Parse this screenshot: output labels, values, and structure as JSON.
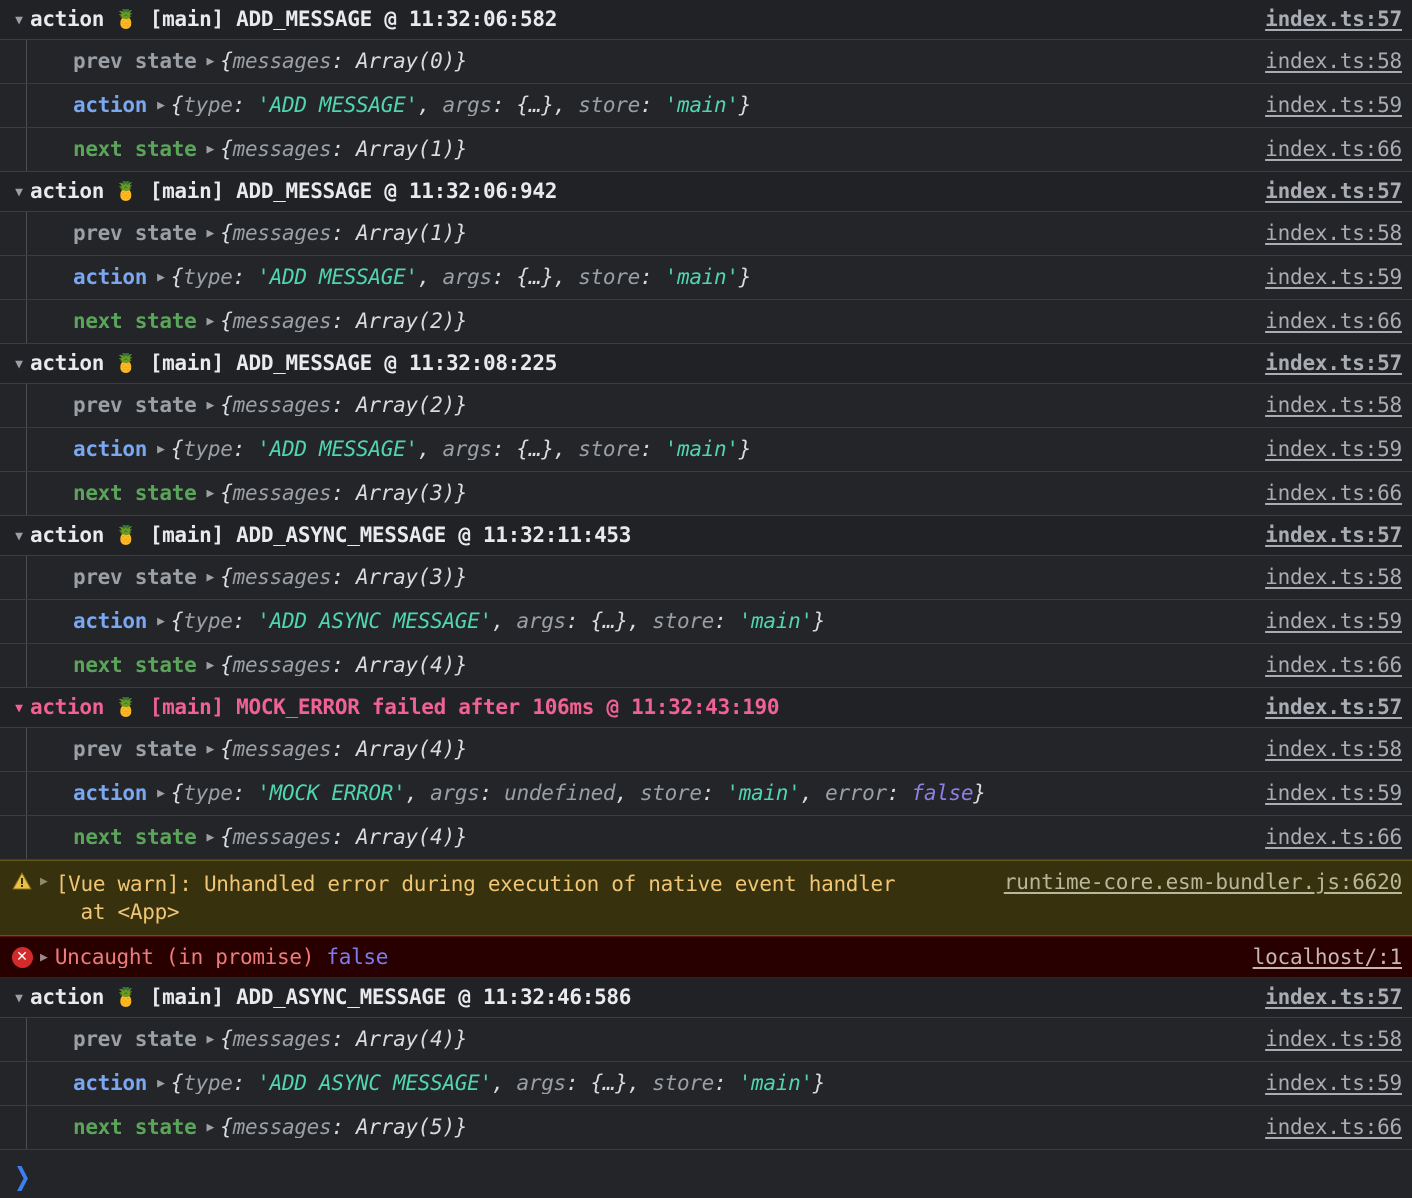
{
  "console": {
    "group_label": "action",
    "store_emoji": "🍍",
    "collapse_arrow": "▼",
    "expand_triangle": "▶",
    "prompt_chevron": "❯",
    "prompt_placeholder": "",
    "prompt_value": "",
    "colors": {
      "background": "#242528",
      "group_header_background": "#212226",
      "row_separator": "#3b3d40",
      "label_prev_state": "#9aa0a6",
      "label_action": "#7aa7f0",
      "label_next_state": "#5ba55b",
      "string_value": "#4fd6b0",
      "boolean_value": "#8c7fe8",
      "error_pink": "#f06292",
      "warning_background": "#37320d",
      "warning_text": "#f0c674",
      "error_background": "#290000",
      "error_text": "#ef7b7b",
      "link": "#a9adb3",
      "prompt_chevron": "#3b7ff0"
    },
    "labels": {
      "prev_state": "prev state",
      "action": "action",
      "next_state": "next state"
    },
    "entries": [
      {
        "kind": "group",
        "header": {
          "label": "action",
          "title": "[main] ADD_MESSAGE @ 11:32:06:582",
          "source": "index.ts:57",
          "failed": false
        },
        "rows": [
          {
            "label": "prev state",
            "label_kind": "prev",
            "source": "index.ts:58",
            "tokens": [
              {
                "t": "punc",
                "v": "{"
              },
              {
                "t": "key",
                "v": "messages"
              },
              {
                "t": "punc",
                "v": ": "
              },
              {
                "t": "obj",
                "v": "Array(0)"
              },
              {
                "t": "punc",
                "v": "}"
              }
            ]
          },
          {
            "label": "action",
            "label_kind": "action",
            "source": "index.ts:59",
            "tokens": [
              {
                "t": "punc",
                "v": "{"
              },
              {
                "t": "key",
                "v": "type"
              },
              {
                "t": "punc",
                "v": ": "
              },
              {
                "t": "str",
                "v": "'ADD_MESSAGE'"
              },
              {
                "t": "punc",
                "v": ", "
              },
              {
                "t": "key",
                "v": "args"
              },
              {
                "t": "punc",
                "v": ": "
              },
              {
                "t": "obj",
                "v": "{…}"
              },
              {
                "t": "punc",
                "v": ", "
              },
              {
                "t": "key",
                "v": "store"
              },
              {
                "t": "punc",
                "v": ": "
              },
              {
                "t": "str",
                "v": "'main'"
              },
              {
                "t": "punc",
                "v": "}"
              }
            ]
          },
          {
            "label": "next state",
            "label_kind": "next",
            "source": "index.ts:66",
            "tokens": [
              {
                "t": "punc",
                "v": "{"
              },
              {
                "t": "key",
                "v": "messages"
              },
              {
                "t": "punc",
                "v": ": "
              },
              {
                "t": "obj",
                "v": "Array(1)"
              },
              {
                "t": "punc",
                "v": "}"
              }
            ]
          }
        ]
      },
      {
        "kind": "group",
        "header": {
          "label": "action",
          "title": "[main] ADD_MESSAGE @ 11:32:06:942",
          "source": "index.ts:57",
          "failed": false
        },
        "rows": [
          {
            "label": "prev state",
            "label_kind": "prev",
            "source": "index.ts:58",
            "tokens": [
              {
                "t": "punc",
                "v": "{"
              },
              {
                "t": "key",
                "v": "messages"
              },
              {
                "t": "punc",
                "v": ": "
              },
              {
                "t": "obj",
                "v": "Array(1)"
              },
              {
                "t": "punc",
                "v": "}"
              }
            ]
          },
          {
            "label": "action",
            "label_kind": "action",
            "source": "index.ts:59",
            "tokens": [
              {
                "t": "punc",
                "v": "{"
              },
              {
                "t": "key",
                "v": "type"
              },
              {
                "t": "punc",
                "v": ": "
              },
              {
                "t": "str",
                "v": "'ADD_MESSAGE'"
              },
              {
                "t": "punc",
                "v": ", "
              },
              {
                "t": "key",
                "v": "args"
              },
              {
                "t": "punc",
                "v": ": "
              },
              {
                "t": "obj",
                "v": "{…}"
              },
              {
                "t": "punc",
                "v": ", "
              },
              {
                "t": "key",
                "v": "store"
              },
              {
                "t": "punc",
                "v": ": "
              },
              {
                "t": "str",
                "v": "'main'"
              },
              {
                "t": "punc",
                "v": "}"
              }
            ]
          },
          {
            "label": "next state",
            "label_kind": "next",
            "source": "index.ts:66",
            "tokens": [
              {
                "t": "punc",
                "v": "{"
              },
              {
                "t": "key",
                "v": "messages"
              },
              {
                "t": "punc",
                "v": ": "
              },
              {
                "t": "obj",
                "v": "Array(2)"
              },
              {
                "t": "punc",
                "v": "}"
              }
            ]
          }
        ]
      },
      {
        "kind": "group",
        "header": {
          "label": "action",
          "title": "[main] ADD_MESSAGE @ 11:32:08:225",
          "source": "index.ts:57",
          "failed": false
        },
        "rows": [
          {
            "label": "prev state",
            "label_kind": "prev",
            "source": "index.ts:58",
            "tokens": [
              {
                "t": "punc",
                "v": "{"
              },
              {
                "t": "key",
                "v": "messages"
              },
              {
                "t": "punc",
                "v": ": "
              },
              {
                "t": "obj",
                "v": "Array(2)"
              },
              {
                "t": "punc",
                "v": "}"
              }
            ]
          },
          {
            "label": "action",
            "label_kind": "action",
            "source": "index.ts:59",
            "tokens": [
              {
                "t": "punc",
                "v": "{"
              },
              {
                "t": "key",
                "v": "type"
              },
              {
                "t": "punc",
                "v": ": "
              },
              {
                "t": "str",
                "v": "'ADD_MESSAGE'"
              },
              {
                "t": "punc",
                "v": ", "
              },
              {
                "t": "key",
                "v": "args"
              },
              {
                "t": "punc",
                "v": ": "
              },
              {
                "t": "obj",
                "v": "{…}"
              },
              {
                "t": "punc",
                "v": ", "
              },
              {
                "t": "key",
                "v": "store"
              },
              {
                "t": "punc",
                "v": ": "
              },
              {
                "t": "str",
                "v": "'main'"
              },
              {
                "t": "punc",
                "v": "}"
              }
            ]
          },
          {
            "label": "next state",
            "label_kind": "next",
            "source": "index.ts:66",
            "tokens": [
              {
                "t": "punc",
                "v": "{"
              },
              {
                "t": "key",
                "v": "messages"
              },
              {
                "t": "punc",
                "v": ": "
              },
              {
                "t": "obj",
                "v": "Array(3)"
              },
              {
                "t": "punc",
                "v": "}"
              }
            ]
          }
        ]
      },
      {
        "kind": "group",
        "header": {
          "label": "action",
          "title": "[main] ADD_ASYNC_MESSAGE @ 11:32:11:453",
          "source": "index.ts:57",
          "failed": false
        },
        "rows": [
          {
            "label": "prev state",
            "label_kind": "prev",
            "source": "index.ts:58",
            "tokens": [
              {
                "t": "punc",
                "v": "{"
              },
              {
                "t": "key",
                "v": "messages"
              },
              {
                "t": "punc",
                "v": ": "
              },
              {
                "t": "obj",
                "v": "Array(3)"
              },
              {
                "t": "punc",
                "v": "}"
              }
            ]
          },
          {
            "label": "action",
            "label_kind": "action",
            "source": "index.ts:59",
            "tokens": [
              {
                "t": "punc",
                "v": "{"
              },
              {
                "t": "key",
                "v": "type"
              },
              {
                "t": "punc",
                "v": ": "
              },
              {
                "t": "str",
                "v": "'ADD_ASYNC_MESSAGE'"
              },
              {
                "t": "punc",
                "v": ", "
              },
              {
                "t": "key",
                "v": "args"
              },
              {
                "t": "punc",
                "v": ": "
              },
              {
                "t": "obj",
                "v": "{…}"
              },
              {
                "t": "punc",
                "v": ", "
              },
              {
                "t": "key",
                "v": "store"
              },
              {
                "t": "punc",
                "v": ": "
              },
              {
                "t": "str",
                "v": "'main'"
              },
              {
                "t": "punc",
                "v": "}"
              }
            ]
          },
          {
            "label": "next state",
            "label_kind": "next",
            "source": "index.ts:66",
            "tokens": [
              {
                "t": "punc",
                "v": "{"
              },
              {
                "t": "key",
                "v": "messages"
              },
              {
                "t": "punc",
                "v": ": "
              },
              {
                "t": "obj",
                "v": "Array(4)"
              },
              {
                "t": "punc",
                "v": "}"
              }
            ]
          }
        ]
      },
      {
        "kind": "group",
        "header": {
          "label": "action",
          "title": "[main] MOCK_ERROR failed after 106ms @ 11:32:43:190",
          "source": "index.ts:57",
          "failed": true
        },
        "rows": [
          {
            "label": "prev state",
            "label_kind": "prev",
            "source": "index.ts:58",
            "tokens": [
              {
                "t": "punc",
                "v": "{"
              },
              {
                "t": "key",
                "v": "messages"
              },
              {
                "t": "punc",
                "v": ": "
              },
              {
                "t": "obj",
                "v": "Array(4)"
              },
              {
                "t": "punc",
                "v": "}"
              }
            ]
          },
          {
            "label": "action",
            "label_kind": "action",
            "source": "index.ts:59",
            "tokens": [
              {
                "t": "punc",
                "v": "{"
              },
              {
                "t": "key",
                "v": "type"
              },
              {
                "t": "punc",
                "v": ": "
              },
              {
                "t": "str",
                "v": "'MOCK_ERROR'"
              },
              {
                "t": "punc",
                "v": ", "
              },
              {
                "t": "key",
                "v": "args"
              },
              {
                "t": "punc",
                "v": ": "
              },
              {
                "t": "und",
                "v": "undefined"
              },
              {
                "t": "punc",
                "v": ", "
              },
              {
                "t": "key",
                "v": "store"
              },
              {
                "t": "punc",
                "v": ": "
              },
              {
                "t": "str",
                "v": "'main'"
              },
              {
                "t": "punc",
                "v": ", "
              },
              {
                "t": "key",
                "v": "error"
              },
              {
                "t": "punc",
                "v": ": "
              },
              {
                "t": "bool",
                "v": "false"
              },
              {
                "t": "punc",
                "v": "}"
              }
            ]
          },
          {
            "label": "next state",
            "label_kind": "next",
            "source": "index.ts:66",
            "tokens": [
              {
                "t": "punc",
                "v": "{"
              },
              {
                "t": "key",
                "v": "messages"
              },
              {
                "t": "punc",
                "v": ": "
              },
              {
                "t": "obj",
                "v": "Array(4)"
              },
              {
                "t": "punc",
                "v": "}"
              }
            ]
          }
        ]
      },
      {
        "kind": "warning",
        "icon": "warning-triangle-icon",
        "text": "[Vue warn]: Unhandled error during execution of native event handler\n  at <App>",
        "source": "runtime-core.esm-bundler.js:6620"
      },
      {
        "kind": "error",
        "icon": "error-circle-icon",
        "text": "Uncaught (in promise) ",
        "value": "false",
        "source": "localhost/:1"
      },
      {
        "kind": "group",
        "header": {
          "label": "action",
          "title": "[main] ADD_ASYNC_MESSAGE @ 11:32:46:586",
          "source": "index.ts:57",
          "failed": false
        },
        "rows": [
          {
            "label": "prev state",
            "label_kind": "prev",
            "source": "index.ts:58",
            "tokens": [
              {
                "t": "punc",
                "v": "{"
              },
              {
                "t": "key",
                "v": "messages"
              },
              {
                "t": "punc",
                "v": ": "
              },
              {
                "t": "obj",
                "v": "Array(4)"
              },
              {
                "t": "punc",
                "v": "}"
              }
            ]
          },
          {
            "label": "action",
            "label_kind": "action",
            "source": "index.ts:59",
            "tokens": [
              {
                "t": "punc",
                "v": "{"
              },
              {
                "t": "key",
                "v": "type"
              },
              {
                "t": "punc",
                "v": ": "
              },
              {
                "t": "str",
                "v": "'ADD_ASYNC_MESSAGE'"
              },
              {
                "t": "punc",
                "v": ", "
              },
              {
                "t": "key",
                "v": "args"
              },
              {
                "t": "punc",
                "v": ": "
              },
              {
                "t": "obj",
                "v": "{…}"
              },
              {
                "t": "punc",
                "v": ", "
              },
              {
                "t": "key",
                "v": "store"
              },
              {
                "t": "punc",
                "v": ": "
              },
              {
                "t": "str",
                "v": "'main'"
              },
              {
                "t": "punc",
                "v": "}"
              }
            ]
          },
          {
            "label": "next state",
            "label_kind": "next",
            "source": "index.ts:66",
            "tokens": [
              {
                "t": "punc",
                "v": "{"
              },
              {
                "t": "key",
                "v": "messages"
              },
              {
                "t": "punc",
                "v": ": "
              },
              {
                "t": "obj",
                "v": "Array(5)"
              },
              {
                "t": "punc",
                "v": "}"
              }
            ]
          }
        ]
      }
    ]
  }
}
